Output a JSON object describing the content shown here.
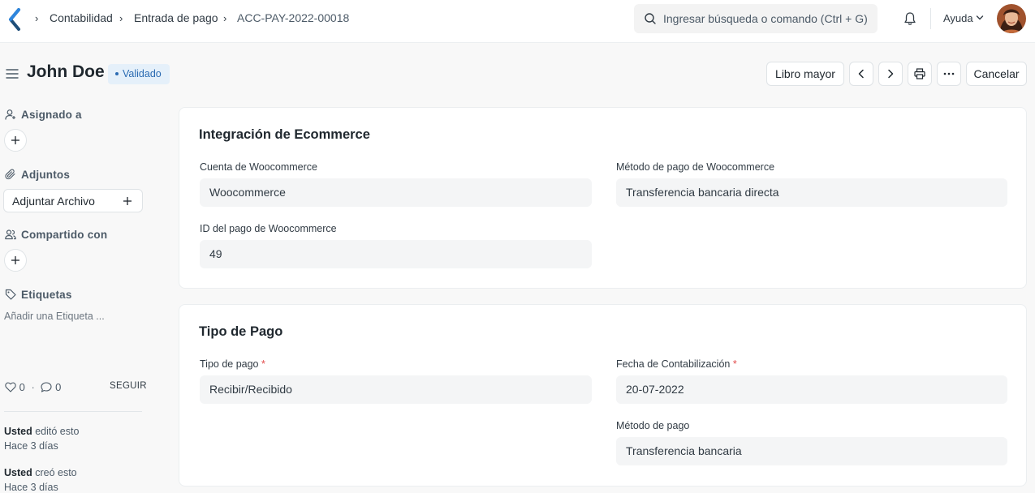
{
  "breadcrumbs": [
    "Contabilidad",
    "Entrada de pago",
    "ACC-PAY-2022-00018"
  ],
  "search": {
    "placeholder": "Ingresar búsqueda o comando (Ctrl + G)"
  },
  "navbar": {
    "help_label": "Ayuda"
  },
  "page": {
    "title": "John Doe",
    "status": "Validado",
    "buttons": {
      "ledger": "Libro mayor",
      "cancel": "Cancelar"
    }
  },
  "sidebar": {
    "assigned_label": "Asignado a",
    "attachments_label": "Adjuntos",
    "attach_button": "Adjuntar Archivo",
    "shared_label": "Compartido con",
    "tags_label": "Etiquetas",
    "add_tag": "Añadir una Etiqueta ...",
    "likes": "0",
    "comments": "0",
    "follow": "SEGUIR",
    "activity": [
      {
        "user": "Usted",
        "action": "editó esto",
        "time": "Hace 3 días"
      },
      {
        "user": "Usted",
        "action": "creó esto",
        "time": "Hace 3 días"
      }
    ]
  },
  "sections": {
    "ecommerce": {
      "title": "Integración de Ecommerce",
      "fields": {
        "account": {
          "label": "Cuenta de Woocommerce",
          "value": "Woocommerce"
        },
        "method": {
          "label": "Método de pago de Woocommerce",
          "value": "Transferencia bancaria directa"
        },
        "payment_id": {
          "label": "ID del pago de Woocommerce",
          "value": "49"
        }
      }
    },
    "payment_type": {
      "title": "Tipo de Pago",
      "fields": {
        "type": {
          "label": "Tipo de pago",
          "value": "Recibir/Recibido"
        },
        "posting_date": {
          "label": "Fecha de Contabilización",
          "value": "20-07-2022"
        },
        "mode": {
          "label": "Método de pago",
          "value": "Transferencia bancaria"
        }
      }
    }
  }
}
